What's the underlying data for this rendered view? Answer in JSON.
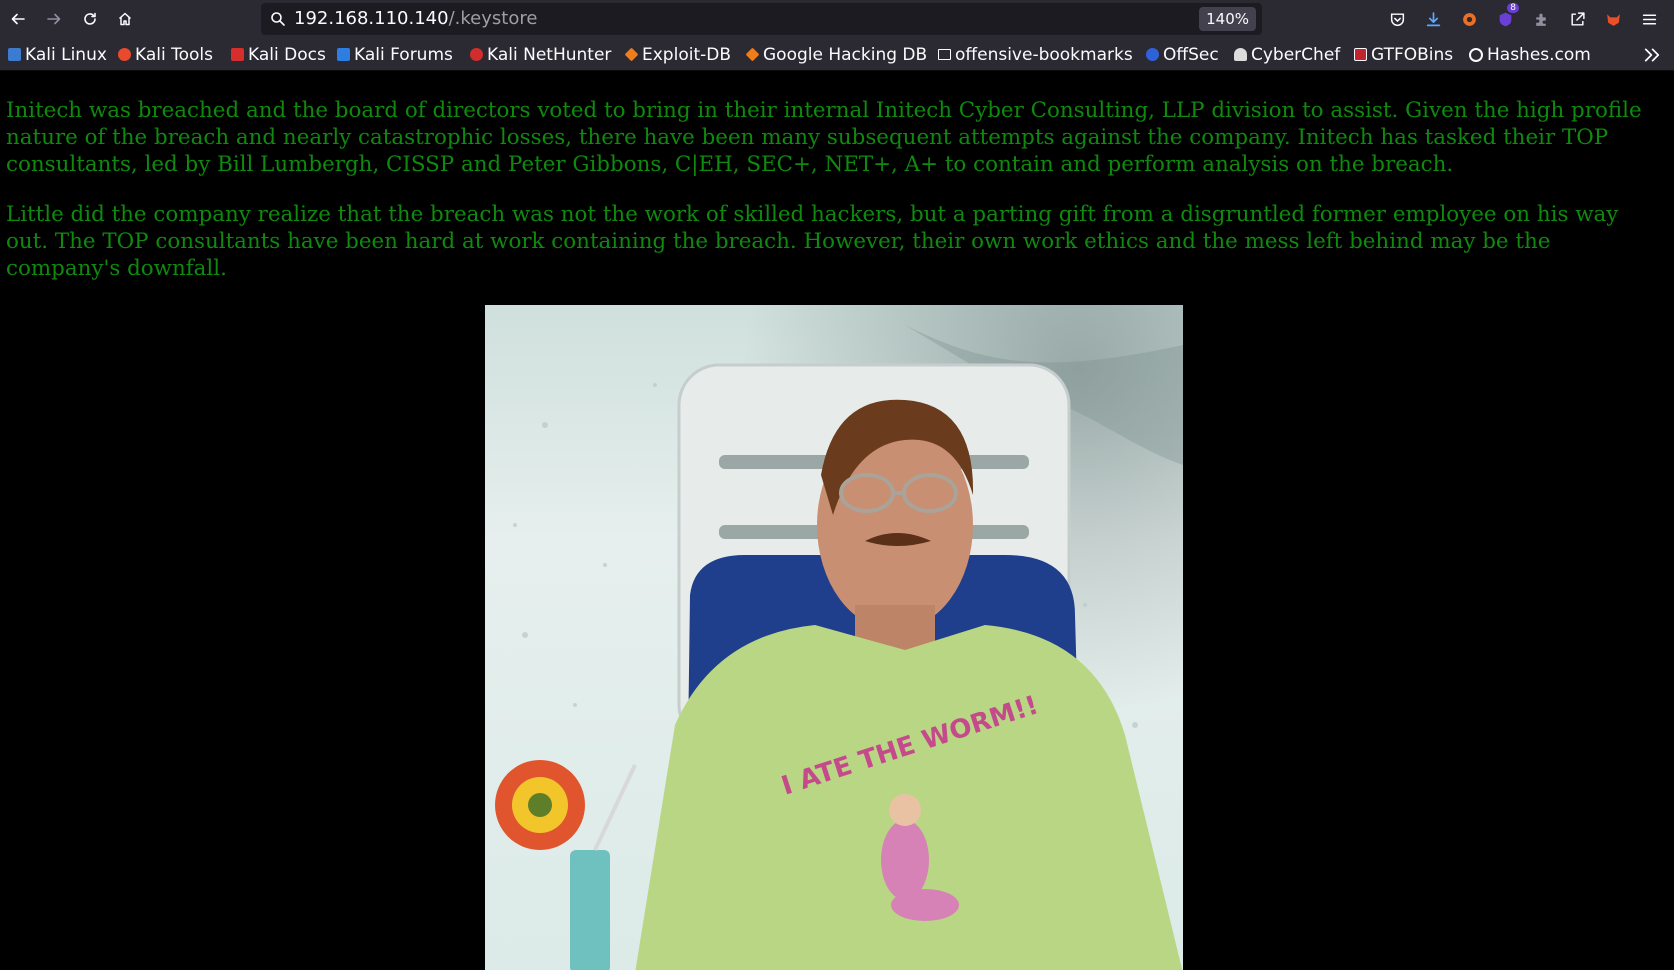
{
  "browser": {
    "url_host": "192.168.110.140",
    "url_path": "/.keystore",
    "zoom": "140%",
    "extension_badge_count": "8"
  },
  "bookmarks": [
    {
      "label": "Kali Linux",
      "icon": "kali-icon",
      "color": "#2a7bd6"
    },
    {
      "label": "Kali Tools",
      "icon": "kali-tools-icon",
      "color": "#e84a2e"
    },
    {
      "label": "Kali Docs",
      "icon": "kali-docs-icon",
      "color": "#d62d2d"
    },
    {
      "label": "Kali Forums",
      "icon": "kali-forums-icon",
      "color": "#2e7de0"
    },
    {
      "label": "Kali NetHunter",
      "icon": "nethunter-icon",
      "color": "#d22d2d"
    },
    {
      "label": "Exploit-DB",
      "icon": "exploitdb-icon",
      "color": "#f07d1a"
    },
    {
      "label": "Google Hacking DB",
      "icon": "ghdb-icon",
      "color": "#f07d1a"
    },
    {
      "label": "offensive-bookmarks",
      "icon": "folder-icon",
      "color": "#fbfbfe"
    },
    {
      "label": "OffSec",
      "icon": "offsec-icon",
      "color": "#2e62d8"
    },
    {
      "label": "CyberChef",
      "icon": "cyberchef-icon",
      "color": "#dcdcdc"
    },
    {
      "label": "GTFOBins",
      "icon": "gtfobins-icon",
      "color": "#c0242e"
    },
    {
      "label": "Hashes.com",
      "icon": "hashes-icon",
      "color": "#fbfbfe"
    }
  ],
  "page": {
    "paragraph1": "Initech was breached and the board of directors voted to bring in their internal Initech Cyber Consulting, LLP division to assist. Given the high profile nature of the breach and nearly catastrophic losses, there have been many subsequent attempts against the company. Initech has tasked their TOP consultants, led by Bill Lumbergh, CISSP and Peter Gibbons, C|EH, SEC+, NET+, A+ to contain and perform analysis on the breach.",
    "paragraph2": "Little did the company realize that the breach was not the work of skilled hackers, but a parting gift from a disgruntled former employee on his way out. The TOP consultants have been hard at work containing the breach. However, their own work ethics and the mess left behind may be the company's downfall.",
    "image_shirt_text": "I ATE THE WORM!!",
    "text_color": "#0f8a0f",
    "background_color": "#000000"
  }
}
